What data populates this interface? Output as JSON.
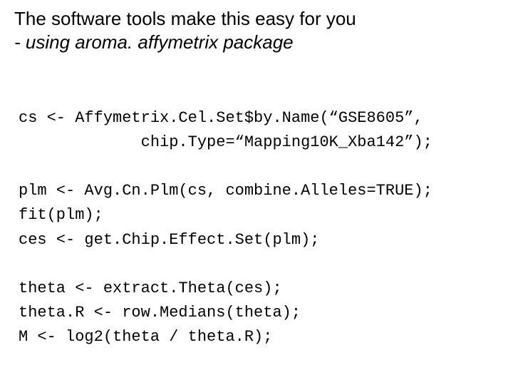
{
  "title": {
    "line1": "The software tools make this easy for you",
    "line2": "- using aroma. affymetrix package"
  },
  "code": {
    "l1": "cs <- Affymetrix.Cel.Set$by.Name(“GSE8605”,",
    "l2": "             chip.Type=“Mapping10K_Xba142”);",
    "l3": "plm <- Avg.Cn.Plm(cs, combine.Alleles=TRUE);",
    "l4": "fit(plm);",
    "l5": "ces <- get.Chip.Effect.Set(plm);",
    "l6": "theta <- extract.Theta(ces);",
    "l7": "theta.R <- row.Medians(theta);",
    "l8": "M <- log2(theta / theta.R);"
  }
}
